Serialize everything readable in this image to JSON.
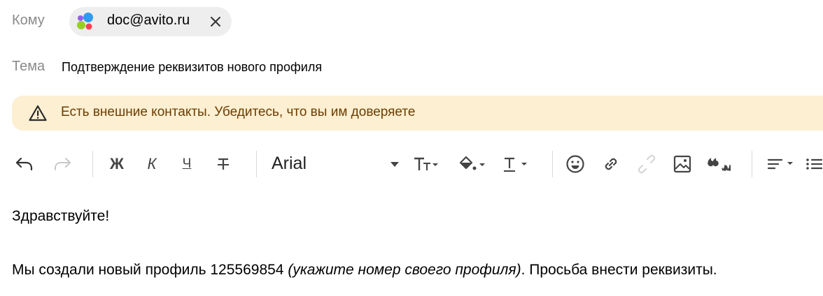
{
  "header": {
    "to_label": "Кому",
    "recipient_email": "doc@avito.ru",
    "subject_label": "Тема",
    "subject_value": "Подтверждение реквизитов нового профиля"
  },
  "warning": {
    "text": "Есть внешние контакты. Убедитесь, что вы им доверяете",
    "icon": "warning-triangle-icon"
  },
  "toolbar": {
    "bold": "Ж",
    "italic": "К",
    "underline": "Ч",
    "font_name": "Arial",
    "icons": [
      "undo-icon",
      "redo-icon",
      "strikethrough-icon",
      "font-size-icon",
      "fill-color-icon",
      "text-color-icon",
      "emoji-icon",
      "link-icon",
      "unlink-icon",
      "image-icon",
      "quote-icon",
      "align-icon",
      "list-icon"
    ]
  },
  "body": {
    "greeting": "Здравствуйте!",
    "para_start": "Мы создали новый профиль 125569854 ",
    "para_italic": "(укажите номер своего профиля)",
    "para_end": ". Просьба внести реквизиты."
  },
  "colors": {
    "warning_bg": "#fdefd2",
    "warning_text": "#6d3d00",
    "chip_bg": "#eeeeee",
    "label_gray": "#8a8a8a"
  }
}
